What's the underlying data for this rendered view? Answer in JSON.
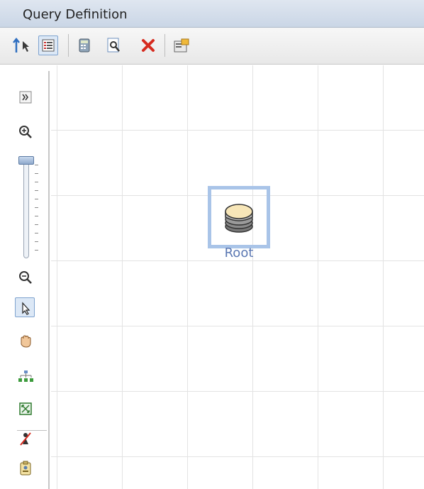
{
  "panel": {
    "title": "Query Definition"
  },
  "toolbar": {
    "items": [
      {
        "icon": "sort-arrows-icon"
      },
      {
        "icon": "list-view-icon",
        "active": true
      },
      {
        "icon": "calculator-icon"
      },
      {
        "icon": "preview-icon"
      },
      {
        "icon": "delete-icon"
      },
      {
        "icon": "properties-icon"
      }
    ]
  },
  "left_toolbar": {
    "items": [
      {
        "icon": "expand-icon"
      },
      {
        "icon": "zoom-in-icon"
      },
      {
        "icon": "zoom-slider"
      },
      {
        "icon": "zoom-out-icon"
      },
      {
        "icon": "select-pointer-icon",
        "active": true
      },
      {
        "icon": "pan-hand-icon"
      },
      {
        "icon": "hierarchy-layout-icon"
      },
      {
        "icon": "fit-to-window-icon"
      },
      {
        "icon": "hide-node-icon"
      },
      {
        "icon": "report-icon"
      }
    ]
  },
  "node": {
    "label": "Root",
    "icon": "database-icon"
  },
  "colors": {
    "node_label": "#5b78b3",
    "selection_border": "#a9c4e8",
    "grid": "#e3e3e3"
  }
}
